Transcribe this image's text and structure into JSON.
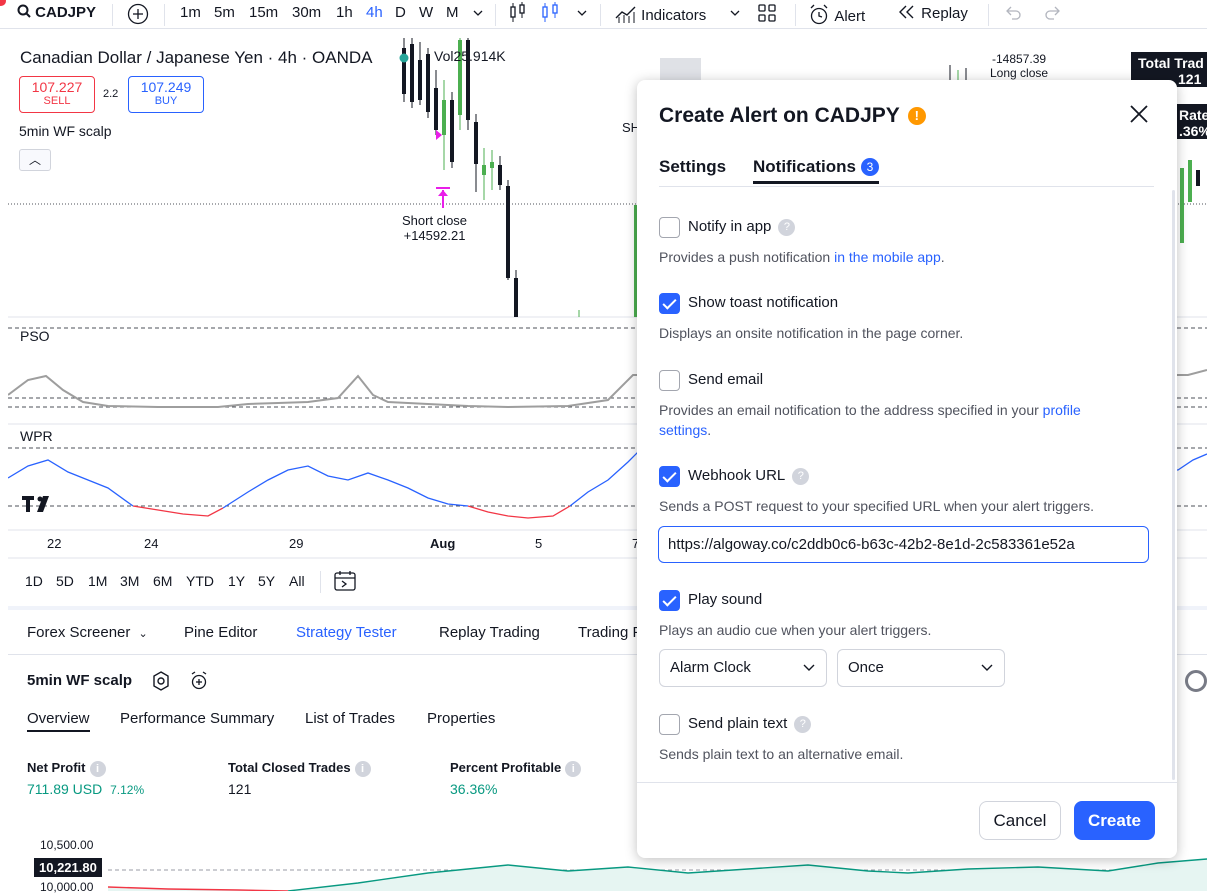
{
  "toolbar": {
    "symbol": "CADJPY",
    "intervals": [
      "1m",
      "5m",
      "15m",
      "30m",
      "1h",
      "4h",
      "D",
      "W",
      "M"
    ],
    "active_interval": "4h",
    "indicators_label": "Indicators",
    "alert_label": "Alert",
    "replay_label": "Replay"
  },
  "chart": {
    "title": "Canadian Dollar / Japanese Yen · 4h · OANDA",
    "sell_price": "107.227",
    "sell_label": "SELL",
    "spread": "2.2",
    "buy_price": "107.249",
    "buy_label": "BUY",
    "volume": "Vol25.914K",
    "strategy": "5min WF scalp",
    "short_close_label": "Short close",
    "short_close_value": "+14592.21",
    "long_close_value": "-14857.39",
    "long_close_label": "Long close",
    "sh_label": "SH",
    "right_tag_1": "Total Trad",
    "right_tag_1b": "121",
    "right_tag_2": "Rate",
    "right_tag_2b": ".36%",
    "panes": [
      "PSO",
      "WPR"
    ],
    "dates": [
      "22",
      "24",
      "29",
      "Aug",
      "5",
      "7"
    ],
    "ranges": [
      "1D",
      "5D",
      "1M",
      "3M",
      "6M",
      "YTD",
      "1Y",
      "5Y",
      "All"
    ]
  },
  "bottom": {
    "tabs": [
      "Forex Screener",
      "Pine Editor",
      "Strategy Tester",
      "Replay Trading",
      "Trading P"
    ],
    "active_tab": "Strategy Tester",
    "strategy_name": "5min WF scalp",
    "subtabs": [
      "Overview",
      "Performance Summary",
      "List of Trades",
      "Properties"
    ],
    "metrics": {
      "net_profit_label": "Net Profit",
      "net_profit_value": "711.89 USD",
      "net_profit_pct": "7.12%",
      "closed_trades_label": "Total Closed Trades",
      "closed_trades_value": "121",
      "pct_profitable_label": "Percent Profitable",
      "pct_profitable_value": "36.36%"
    },
    "equity_axis": [
      "10,500.00",
      "10,221.80",
      "10,000.00"
    ]
  },
  "dialog": {
    "title": "Create Alert on CADJPY",
    "tab_settings": "Settings",
    "tab_notifications": "Notifications",
    "notifications_count": "3",
    "options": [
      {
        "label": "Notify in app",
        "checked": false,
        "desc_pre": "Provides a push notification ",
        "desc_link": "in the mobile app",
        "desc_post": "."
      },
      {
        "label": "Show toast notification",
        "checked": true,
        "desc_pre": "Displays an onsite notification in the page corner.",
        "desc_link": "",
        "desc_post": ""
      },
      {
        "label": "Send email",
        "checked": false,
        "desc_pre": "Provides an email notification to the address specified in your ",
        "desc_link": "profile settings",
        "desc_post": "."
      },
      {
        "label": "Webhook URL",
        "checked": true,
        "desc_pre": "Sends a POST request to your specified URL when your alert triggers.",
        "desc_link": "",
        "desc_post": ""
      },
      {
        "label": "Play sound",
        "checked": true,
        "desc_pre": "Plays an audio cue when your alert triggers.",
        "desc_link": "",
        "desc_post": ""
      },
      {
        "label": "Send plain text",
        "checked": false,
        "desc_pre": "Sends plain text to an alternative email.",
        "desc_link": "",
        "desc_post": ""
      }
    ],
    "webhook_url": "https://algoway.co/c2ddb0c6-b63c-42b2-8e1d-2c583361e52a",
    "sound": "Alarm Clock",
    "sound_repeat": "Once",
    "cancel_label": "Cancel",
    "create_label": "Create"
  },
  "colors": {
    "accent": "#2962ff",
    "sell": "#f23645",
    "profit": "#089981",
    "warning": "#ff9800"
  }
}
